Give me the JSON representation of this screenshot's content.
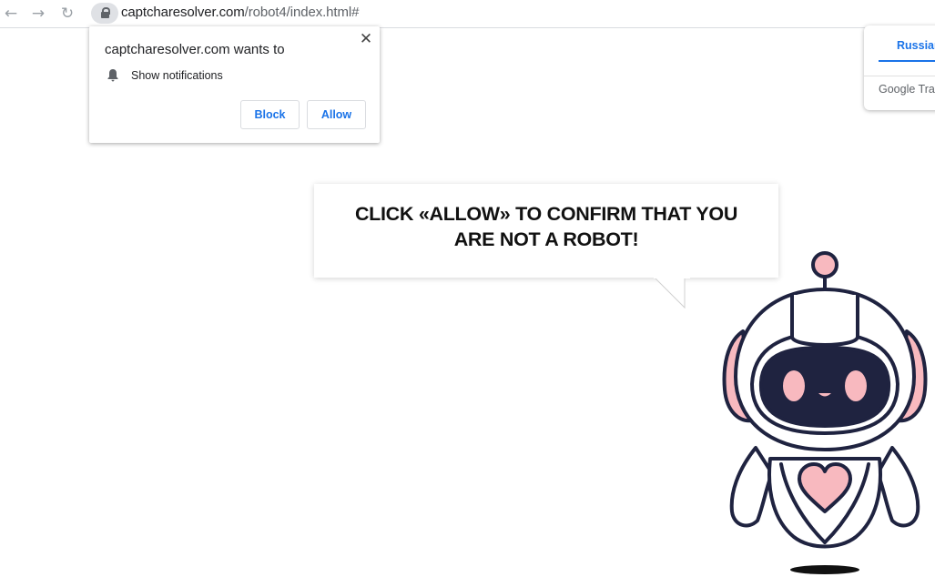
{
  "browser": {
    "url_domain": "captcharesolver.com",
    "url_path": "/robot4/index.html#",
    "back_icon": "arrow-left-icon",
    "forward_icon": "arrow-right-icon",
    "reload_icon": "reload-icon",
    "lock_icon": "lock-icon"
  },
  "notification_prompt": {
    "title": "captcharesolver.com wants to",
    "permission": "Show notifications",
    "block_label": "Block",
    "allow_label": "Allow",
    "close_icon": "close-icon",
    "bell_icon": "bell-icon"
  },
  "translate_popup": {
    "tab_label": "Russian",
    "brand": "Google Tran"
  },
  "page": {
    "message_line1": "CLICK «ALLOW» TO CONFIRM THAT YOU",
    "message_line2": "ARE NOT A ROBOT!"
  },
  "colors": {
    "accent": "#1a73e8",
    "robot_outline": "#1f2340",
    "robot_pink": "#f8b9bf"
  }
}
